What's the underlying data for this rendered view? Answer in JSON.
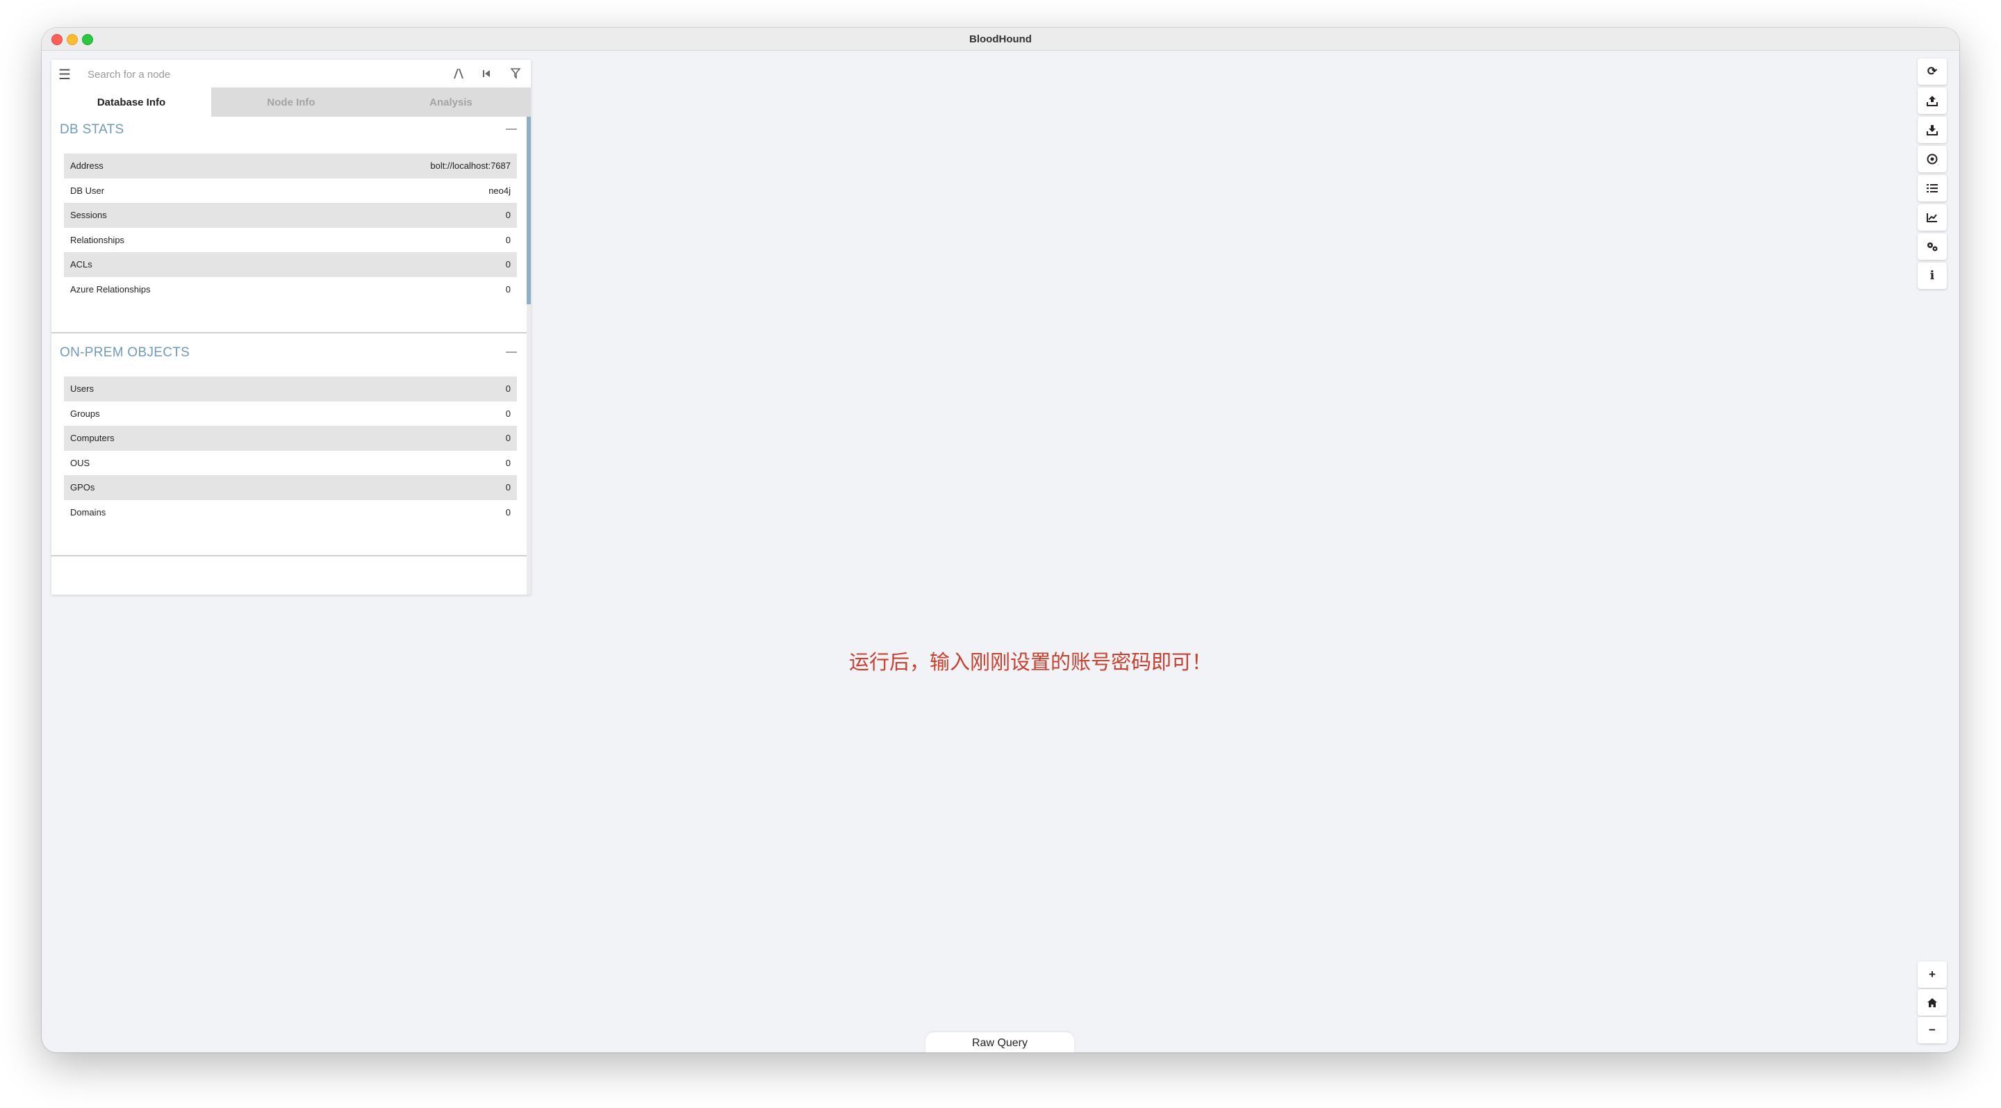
{
  "window": {
    "title": "BloodHound"
  },
  "search": {
    "placeholder": "Search for a node"
  },
  "tabs": [
    {
      "label": "Database Info",
      "active": true
    },
    {
      "label": "Node Info",
      "active": false
    },
    {
      "label": "Analysis",
      "active": false
    }
  ],
  "db_stats": {
    "title": "DB STATS",
    "rows": [
      {
        "label": "Address",
        "value": "bolt://localhost:7687"
      },
      {
        "label": "DB User",
        "value": "neo4j"
      },
      {
        "label": "Sessions",
        "value": "0"
      },
      {
        "label": "Relationships",
        "value": "0"
      },
      {
        "label": "ACLs",
        "value": "0"
      },
      {
        "label": "Azure Relationships",
        "value": "0"
      }
    ]
  },
  "onprem": {
    "title": "ON-PREM OBJECTS",
    "rows": [
      {
        "label": "Users",
        "value": "0"
      },
      {
        "label": "Groups",
        "value": "0"
      },
      {
        "label": "Computers",
        "value": "0"
      },
      {
        "label": "OUS",
        "value": "0"
      },
      {
        "label": "GPOs",
        "value": "0"
      },
      {
        "label": "Domains",
        "value": "0"
      }
    ]
  },
  "toolbar_icons": [
    "refresh-icon",
    "upload-icon",
    "download-icon",
    "target-icon",
    "query-list-icon",
    "chart-icon",
    "settings-icon",
    "info-icon"
  ],
  "zoom_icons": [
    "zoom-in-icon",
    "home-icon",
    "zoom-out-icon"
  ],
  "annotation": "运行后，输入刚刚设置的账号密码即可！",
  "raw_query_label": "Raw Query",
  "colors": {
    "accent": "#6f9bb8",
    "annotation": "#c8402f",
    "background": "#f2f3f7"
  }
}
